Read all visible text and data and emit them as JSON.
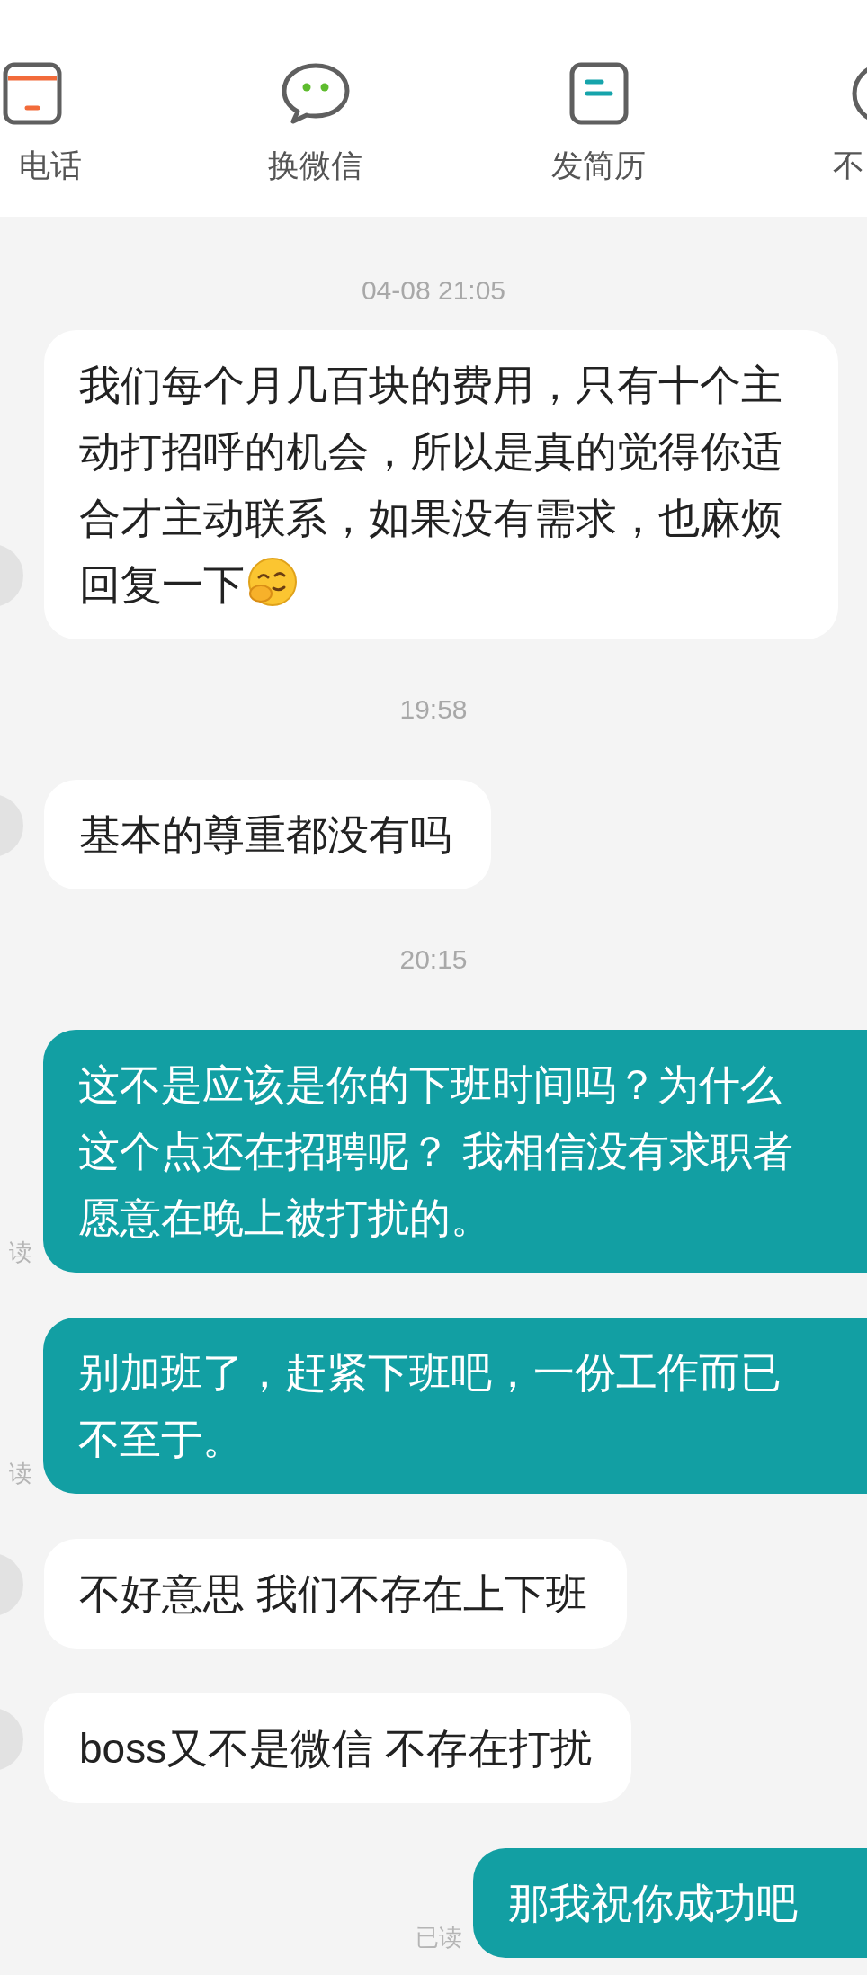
{
  "actions": [
    {
      "kind": "card",
      "label": "电话"
    },
    {
      "kind": "chat",
      "label": "换微信"
    },
    {
      "kind": "document",
      "label": "发简历"
    },
    {
      "kind": "circle",
      "label": "不"
    }
  ],
  "messages": [
    {
      "kind": "time",
      "text": "04-08 21:05"
    },
    {
      "kind": "received",
      "text": "我们每个月几百块的费用，只有十个主动打招呼的机会，所以是真的觉得你适合才主动联系，如果没有需求，也麻烦回复一下",
      "emoji": true
    },
    {
      "kind": "time",
      "text": "19:58"
    },
    {
      "kind": "received",
      "text": "基本的尊重都没有吗",
      "emoji": false
    },
    {
      "kind": "time",
      "text": "20:15"
    },
    {
      "kind": "sent",
      "text": "这不是应该是你的下班时间吗？为什么这个点还在招聘呢？ 我相信没有求职者愿意在晚上被打扰的。",
      "status": "读"
    },
    {
      "kind": "sent",
      "text": "别加班了，赶紧下班吧，一份工作而已不至于。",
      "status": "读"
    },
    {
      "kind": "received",
      "text": "不好意思 我们不存在上下班",
      "emoji": false
    },
    {
      "kind": "received",
      "text": "boss又不是微信 不存在打扰",
      "emoji": false
    },
    {
      "kind": "sent",
      "text": "那我祝你成功吧",
      "status": "已读"
    }
  ]
}
